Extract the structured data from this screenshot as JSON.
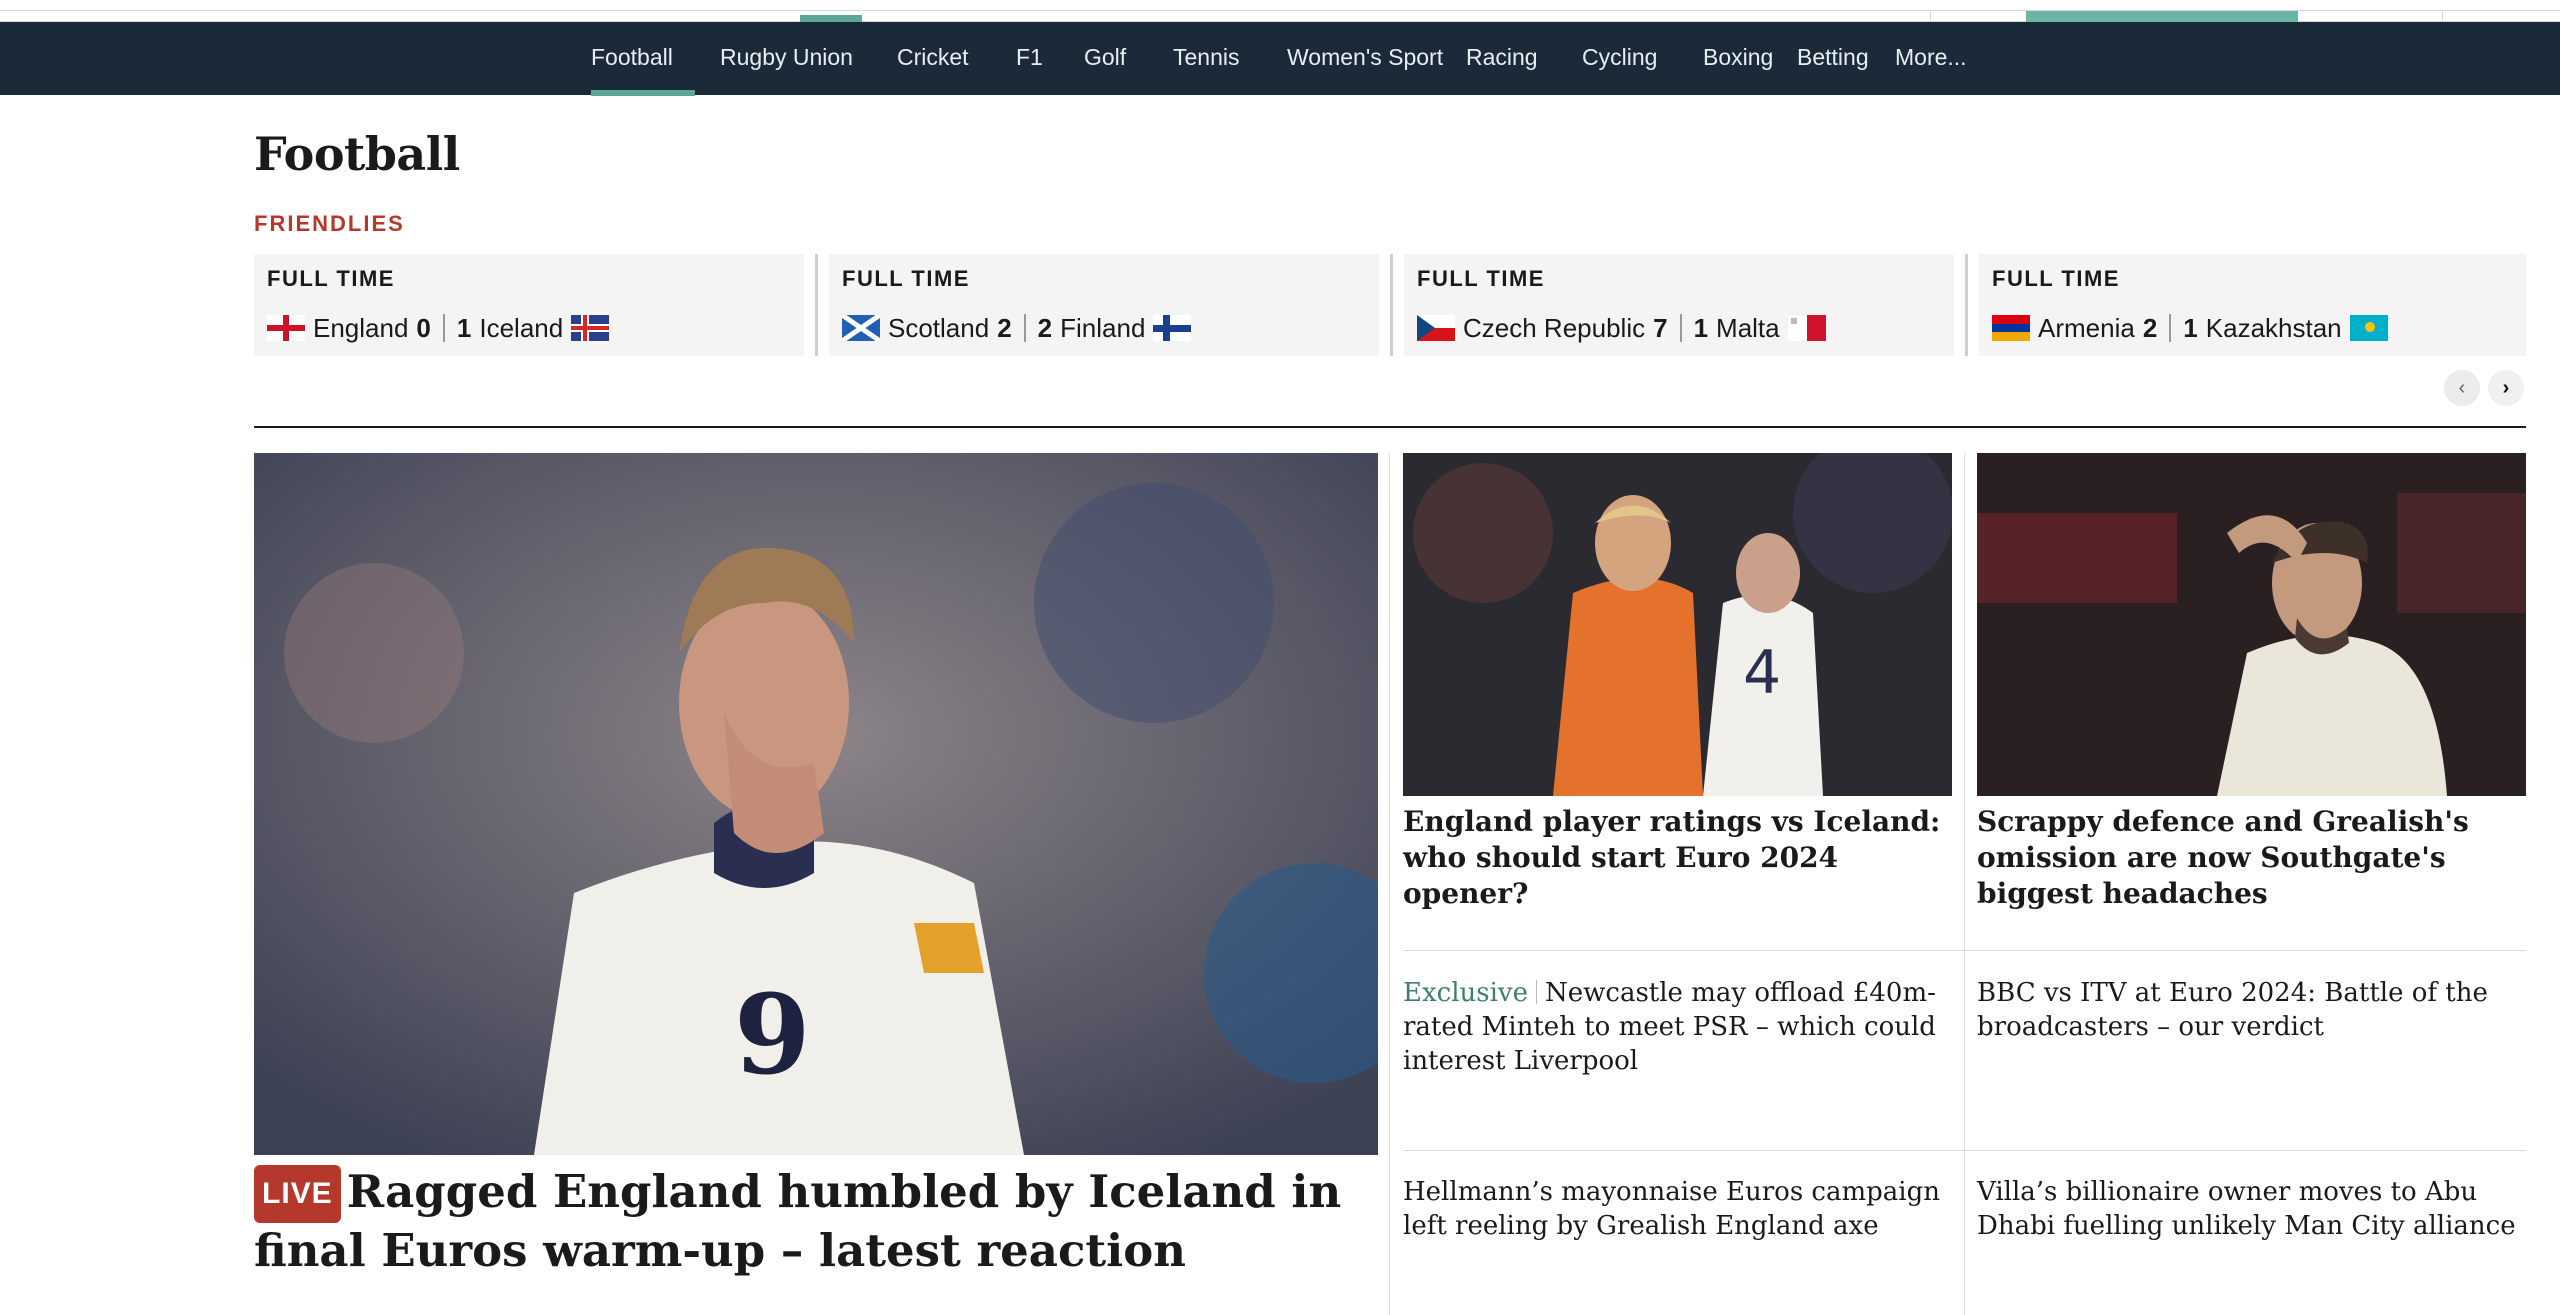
{
  "nav": {
    "items": [
      {
        "label": "Football"
      },
      {
        "label": "Rugby Union"
      },
      {
        "label": "Cricket"
      },
      {
        "label": "F1"
      },
      {
        "label": "Golf"
      },
      {
        "label": "Tennis"
      },
      {
        "label": "Women's Sport"
      },
      {
        "label": "Racing"
      },
      {
        "label": "Cycling"
      },
      {
        "label": "Boxing"
      },
      {
        "label": "Betting"
      },
      {
        "label": "More..."
      }
    ],
    "active": "Football"
  },
  "page": {
    "title": "Football",
    "competition": "FRIENDLIES"
  },
  "scores": [
    {
      "status": "FULL TIME",
      "home": "England",
      "home_score": "0",
      "away_score": "1",
      "away": "Iceland"
    },
    {
      "status": "FULL TIME",
      "home": "Scotland",
      "home_score": "2",
      "away_score": "2",
      "away": "Finland"
    },
    {
      "status": "FULL TIME",
      "home": "Czech Republic",
      "home_score": "7",
      "away_score": "1",
      "away": "Malta"
    },
    {
      "status": "FULL TIME",
      "home": "Armenia",
      "home_score": "2",
      "away_score": "1",
      "away": "Kazakhstan"
    }
  ],
  "carousel": {
    "prev_icon": "chevron-left-icon",
    "next_icon": "chevron-right-icon"
  },
  "lead": {
    "badge": "LIVE",
    "headline": "Ragged England humbled by Iceland in final Euros warm-up – latest reaction"
  },
  "stories": [
    {
      "headline": "England player ratings vs Iceland: who should start Euro 2024 opener?"
    },
    {
      "headline": "Scrappy defence and Grealish's omission are now Southgate's biggest headaches"
    },
    {
      "kicker": "Exclusive",
      "headline": "Newcastle may offload £40m-rated Minteh to meet PSR – which could interest Liverpool"
    },
    {
      "headline": "BBC vs ITV at Euro 2024: Battle of the broadcasters – our verdict"
    },
    {
      "headline": "Hellmann’s mayonnaise Euros campaign left reeling by Grealish England axe"
    },
    {
      "headline": "Villa’s billionaire owner moves to Abu Dhabi fuelling unlikely Man City alliance"
    }
  ],
  "colors": {
    "nav_bg": "#1b2a39",
    "accent": "#5fa69a",
    "live": "#b5382c",
    "exclusive": "#3f7d70"
  }
}
